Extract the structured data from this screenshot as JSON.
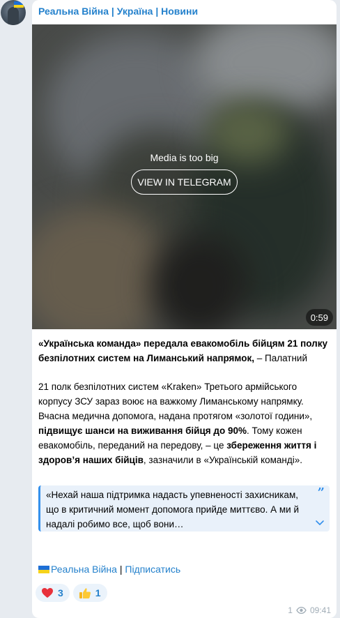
{
  "channel": {
    "name": "Реальна Війна | Україна | Новини"
  },
  "media": {
    "too_big_text": "Media is too big",
    "view_button_label": "VIEW IN TELEGRAM",
    "duration": "0:59"
  },
  "post": {
    "p1": {
      "bold": "«Українська команда» передала евакомобіль бійцям 21 полку безпілотних систем на Лиманський напрямок,",
      "rest": " – Палатний"
    },
    "p2": {
      "t1": "21 полк безпілотних систем «Kraken» Третього армійського корпусу ЗСУ зараз воює на важкому Лиманському напрямку. Вчасна медична допомога, надана протягом «золотої години», ",
      "b1": "підвищує шанси на виживання бійця до 90%",
      "t2": ". Тому кожен евакомобіль, переданий на передову, – це ",
      "b2": "збереження життя і здоров’я наших бійців",
      "t3": ", зазначили в «Українській команді»."
    },
    "quote": "«Нехай наша підтримка надасть упевненості захисникам, що в критичний момент допомога прийде миттєво. А ми й надалі робимо все, щоб вони…",
    "footer": {
      "link1": "Реальна Війна",
      "sep": " | ",
      "link2": "Підписатись"
    }
  },
  "reactions": [
    {
      "icon": "heart-icon",
      "count": "3"
    },
    {
      "icon": "thumbs-up-icon",
      "count": "1"
    }
  ],
  "meta": {
    "views": "1",
    "time": "09:41"
  },
  "colors": {
    "accent": "#2481cc",
    "quote_border": "#3390ec",
    "quote_bg": "#e9f1fa",
    "background": "#e7ebf0"
  }
}
